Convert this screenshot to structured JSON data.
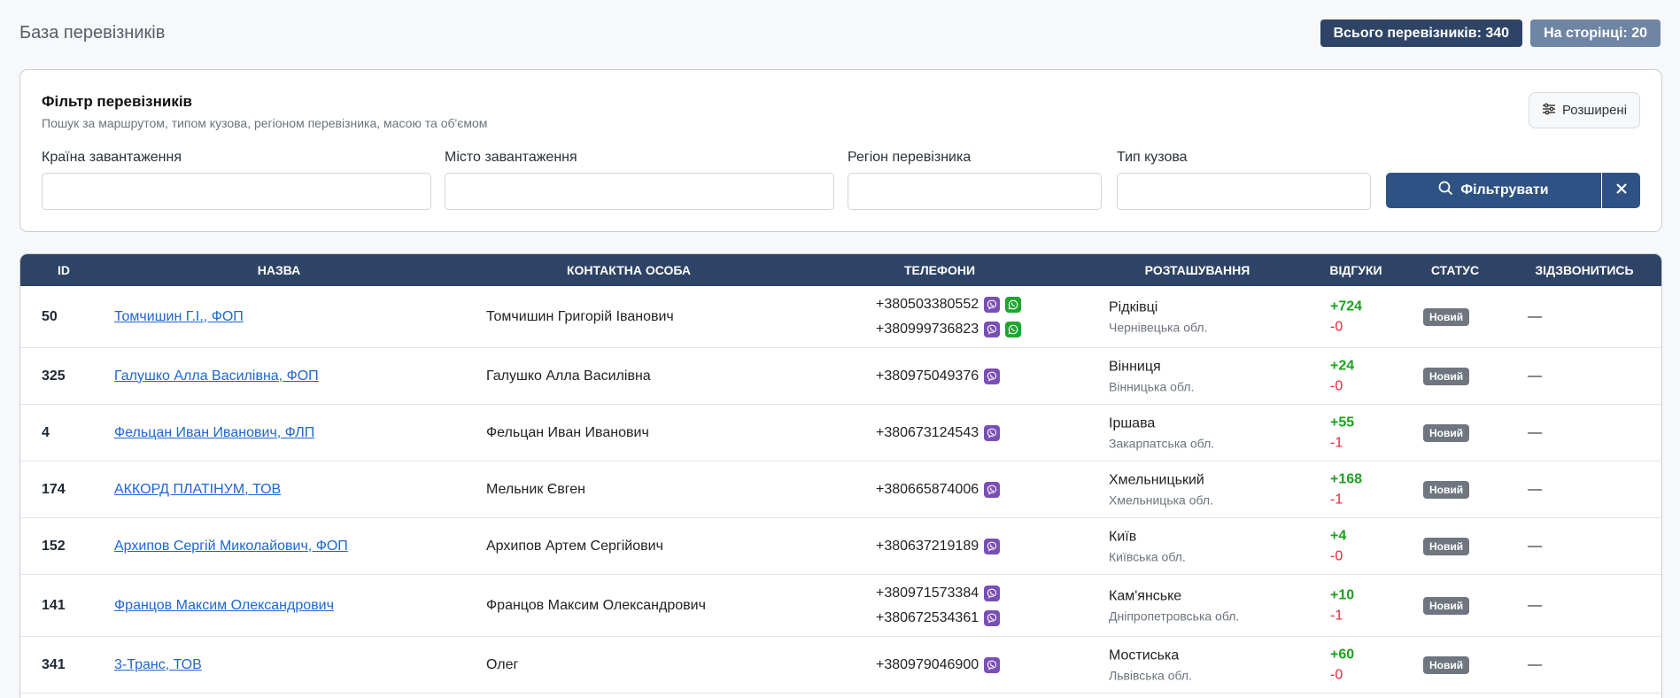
{
  "header": {
    "title": "База перевізників",
    "total_badge": "Всього перевізників: 340",
    "page_badge": "На сторінці: 20"
  },
  "filter": {
    "title": "Фільтр перевізників",
    "subtitle": "Пошук за маршрутом, типом кузова, регіоном перевізника, масою та об'ємом",
    "advanced_label": "Розширені",
    "fields": [
      {
        "label": "Країна завантаження",
        "value": ""
      },
      {
        "label": "Місто завантаження",
        "value": ""
      },
      {
        "label": "Регіон перевізника",
        "value": ""
      },
      {
        "label": "Тип кузова",
        "value": ""
      }
    ],
    "submit_label": "Фільтрувати"
  },
  "table": {
    "columns": [
      "ID",
      "НАЗВА",
      "КОНТАКТНА ОСОБА",
      "ТЕЛЕФОНИ",
      "РОЗТАШУВАННЯ",
      "ВІДГУКИ",
      "СТАТУС",
      "ЗІДЗВОНИТИСЬ"
    ],
    "rows": [
      {
        "id": "50",
        "name": "Томчишин Г.І., ФОП",
        "contact": "Томчишин Григорій Іванович",
        "phones": [
          {
            "number": "+380503380552",
            "apps": [
              "viber",
              "whatsapp"
            ]
          },
          {
            "number": "+380999736823",
            "apps": [
              "viber",
              "whatsapp"
            ]
          }
        ],
        "city": "Рідківці",
        "region": "Чернівецька обл.",
        "pos": "+724",
        "neg": "-0",
        "status": "Новий",
        "called": "—"
      },
      {
        "id": "325",
        "name": "Галушко Алла Василівна, ФОП",
        "contact": "Галушко Алла Василівна",
        "phones": [
          {
            "number": "+380975049376",
            "apps": [
              "viber"
            ]
          }
        ],
        "city": "Вінниця",
        "region": "Вінницька обл.",
        "pos": "+24",
        "neg": "-0",
        "status": "Новий",
        "called": "—"
      },
      {
        "id": "4",
        "name": "Фельцан Иван Иванович, ФЛП",
        "contact": "Фельцан Иван Иванович",
        "phones": [
          {
            "number": "+380673124543",
            "apps": [
              "viber"
            ]
          }
        ],
        "city": "Іршава",
        "region": "Закарпатська обл.",
        "pos": "+55",
        "neg": "-1",
        "status": "Новий",
        "called": "—"
      },
      {
        "id": "174",
        "name": "АККОРД ПЛАТІНУМ, ТОВ",
        "contact": "Мельник Євген",
        "phones": [
          {
            "number": "+380665874006",
            "apps": [
              "viber"
            ]
          }
        ],
        "city": "Хмельницький",
        "region": "Хмельницька обл.",
        "pos": "+168",
        "neg": "-1",
        "status": "Новий",
        "called": "—"
      },
      {
        "id": "152",
        "name": "Архипов Сергій Миколайович, ФОП",
        "contact": "Архипов Артем Сергійович",
        "phones": [
          {
            "number": "+380637219189",
            "apps": [
              "viber"
            ]
          }
        ],
        "city": "Київ",
        "region": "Київська обл.",
        "pos": "+4",
        "neg": "-0",
        "status": "Новий",
        "called": "—"
      },
      {
        "id": "141",
        "name": "Францов Максим Олександрович",
        "contact": "Францов Максим Олександрович",
        "phones": [
          {
            "number": "+380971573384",
            "apps": [
              "viber"
            ]
          },
          {
            "number": "+380672534361",
            "apps": [
              "viber"
            ]
          }
        ],
        "city": "Кам'янське",
        "region": "Дніпропетровська обл.",
        "pos": "+10",
        "neg": "-1",
        "status": "Новий",
        "called": "—"
      },
      {
        "id": "341",
        "name": "3-Транс, ТОВ",
        "contact": "Олег",
        "phones": [
          {
            "number": "+380979046900",
            "apps": [
              "viber"
            ]
          }
        ],
        "city": "Мостиська",
        "region": "Львівська обл.",
        "pos": "+60",
        "neg": "-0",
        "status": "Новий",
        "called": "—"
      }
    ]
  }
}
